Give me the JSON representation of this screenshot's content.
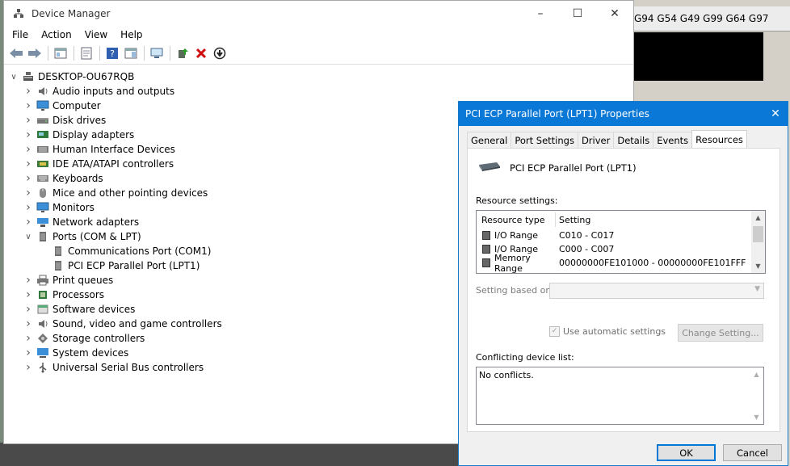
{
  "background": {
    "gcode_text": "G94 G54 G49 G99 G64 G97"
  },
  "device_manager": {
    "title": "Device Manager",
    "menu": [
      "File",
      "Action",
      "View",
      "Help"
    ],
    "toolbar_icons": [
      "back-icon",
      "forward-icon",
      "show-hide-console-tree-icon",
      "properties-icon",
      "help-icon",
      "action-pane-icon",
      "scan-hardware-icon",
      "update-driver-icon",
      "uninstall-icon",
      "disable-device-icon"
    ],
    "computer_name": "DESKTOP-OU67RQB",
    "categories": [
      {
        "label": "Audio inputs and outputs",
        "icon": "speaker-icon",
        "expanded": false
      },
      {
        "label": "Computer",
        "icon": "monitor-icon",
        "expanded": false
      },
      {
        "label": "Disk drives",
        "icon": "disk-icon",
        "expanded": false
      },
      {
        "label": "Display adapters",
        "icon": "display-adapter-icon",
        "expanded": false
      },
      {
        "label": "Human Interface Devices",
        "icon": "hid-icon",
        "expanded": false
      },
      {
        "label": "IDE ATA/ATAPI controllers",
        "icon": "ide-icon",
        "expanded": false
      },
      {
        "label": "Keyboards",
        "icon": "keyboard-icon",
        "expanded": false
      },
      {
        "label": "Mice and other pointing devices",
        "icon": "mouse-icon",
        "expanded": false
      },
      {
        "label": "Monitors",
        "icon": "monitor-icon",
        "expanded": false
      },
      {
        "label": "Network adapters",
        "icon": "network-icon",
        "expanded": false
      },
      {
        "label": "Ports (COM & LPT)",
        "icon": "port-icon",
        "expanded": true,
        "children": [
          {
            "label": "Communications Port (COM1)",
            "icon": "port-icon"
          },
          {
            "label": "PCI ECP Parallel Port (LPT1)",
            "icon": "port-icon"
          }
        ]
      },
      {
        "label": "Print queues",
        "icon": "printer-icon",
        "expanded": false
      },
      {
        "label": "Processors",
        "icon": "processor-icon",
        "expanded": false
      },
      {
        "label": "Software devices",
        "icon": "software-icon",
        "expanded": false
      },
      {
        "label": "Sound, video and game controllers",
        "icon": "speaker-icon",
        "expanded": false
      },
      {
        "label": "Storage controllers",
        "icon": "storage-icon",
        "expanded": false
      },
      {
        "label": "System devices",
        "icon": "system-icon",
        "expanded": false
      },
      {
        "label": "Universal Serial Bus controllers",
        "icon": "usb-icon",
        "expanded": false
      }
    ]
  },
  "properties": {
    "title": "PCI ECP Parallel Port (LPT1) Properties",
    "tabs": [
      "General",
      "Port Settings",
      "Driver",
      "Details",
      "Events",
      "Resources"
    ],
    "active_tab": "Resources",
    "device_name": "PCI ECP Parallel Port (LPT1)",
    "resource_settings_label": "Resource settings:",
    "columns": [
      "Resource type",
      "Setting"
    ],
    "resources": [
      {
        "type": "I/O Range",
        "setting": "C010 - C017"
      },
      {
        "type": "I/O Range",
        "setting": "C000 - C007"
      },
      {
        "type": "Memory Range",
        "setting": "00000000FE101000 - 00000000FE101FFF"
      }
    ],
    "setting_based_on_label": "Setting based on:",
    "use_automatic_label": "Use automatic settings",
    "change_setting_label": "Change Setting...",
    "conflicting_label": "Conflicting device list:",
    "conflicts_text": "No conflicts.",
    "ok_label": "OK",
    "cancel_label": "Cancel"
  }
}
